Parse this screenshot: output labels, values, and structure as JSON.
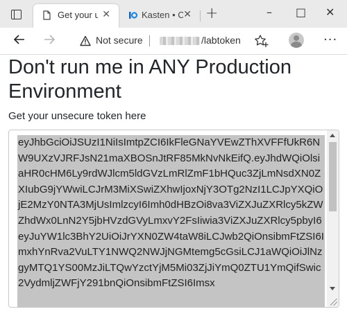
{
  "browser": {
    "tabs": [
      {
        "label": "Get your u",
        "active": true
      },
      {
        "label": "Kasten • C",
        "active": false
      }
    ],
    "new_tab_icon": "plus-icon",
    "address": {
      "security_label": "Not secure",
      "path": "/labtoken"
    },
    "controls": {
      "minimize": "–",
      "maximize": "□",
      "close": "✕"
    }
  },
  "page": {
    "title": "Don't run me in ANY Production Environment",
    "subtitle": "Get your unsecure token here",
    "token": "eyJhbGciOiJSUzI1NiIsImtpZCI6IkFleGNaYVEwZThXVFFfUkR6NW9UXzVJRFJsN21maXBOSnJtRF85MkNvNkEifQ.eyJhdWQiOlsiaHR0cHM6Ly9rdWJlcm5ldGVzLmRlZmF1bHQuc3ZjLmNsdXN0ZXIubG9jYWwiLCJrM3MiXSwiZXhwIjoxNjY3OTg2NzI1LCJpYXQiOjE2MzY0NTA3MjUsImlzcyI6Imh0dHBzOi8va3ViZXJuZXRlcy5kZWZhdWx0LnN2Y5jbHVzdGVyLmxvY2FsIiwia3ViZXJuZXRlcy5pbyI6eyJuYW1lc3BhY2UiOiJrYXN0ZW4taW8iLCJwb2QiOnsibmFtZSI6ImxhYnRva2VuLTY1NWQ2NWJjNGMtemg5cGsiLCJ1aWQiOiJlNzgyMTQ1YS00MzJiLTQwYzctYjM5Mi03ZjJiYmQ0ZTU1YmQifSwic2VydmljZWFjY291bnQiOnsibmFtZSI6Imsx"
  }
}
